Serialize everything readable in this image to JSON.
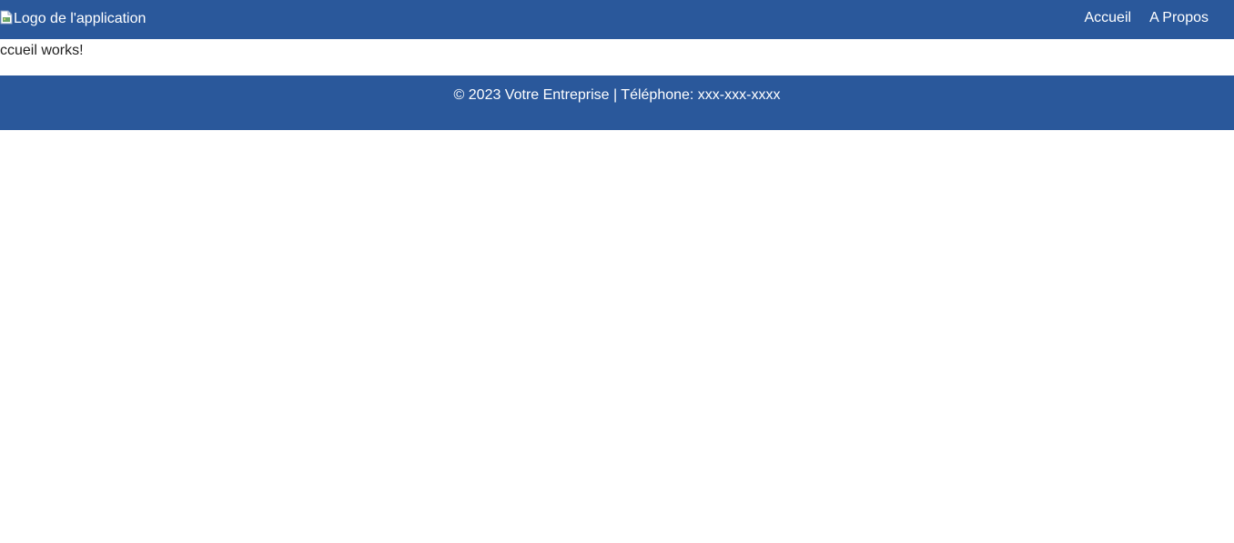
{
  "header": {
    "logo_alt": "Logo de l'application",
    "nav": [
      {
        "label": "Accueil"
      },
      {
        "label": "A Propos"
      }
    ]
  },
  "main": {
    "content_text": "ccueil works!"
  },
  "footer": {
    "text": "© 2023 Votre Entreprise | Téléphone: xxx-xxx-xxxx"
  },
  "colors": {
    "primary": "#2a589b",
    "text_light": "#ffffff",
    "text_dark": "#222222",
    "background": "#ffffff"
  },
  "icons": {
    "logo": "broken-image-icon"
  }
}
